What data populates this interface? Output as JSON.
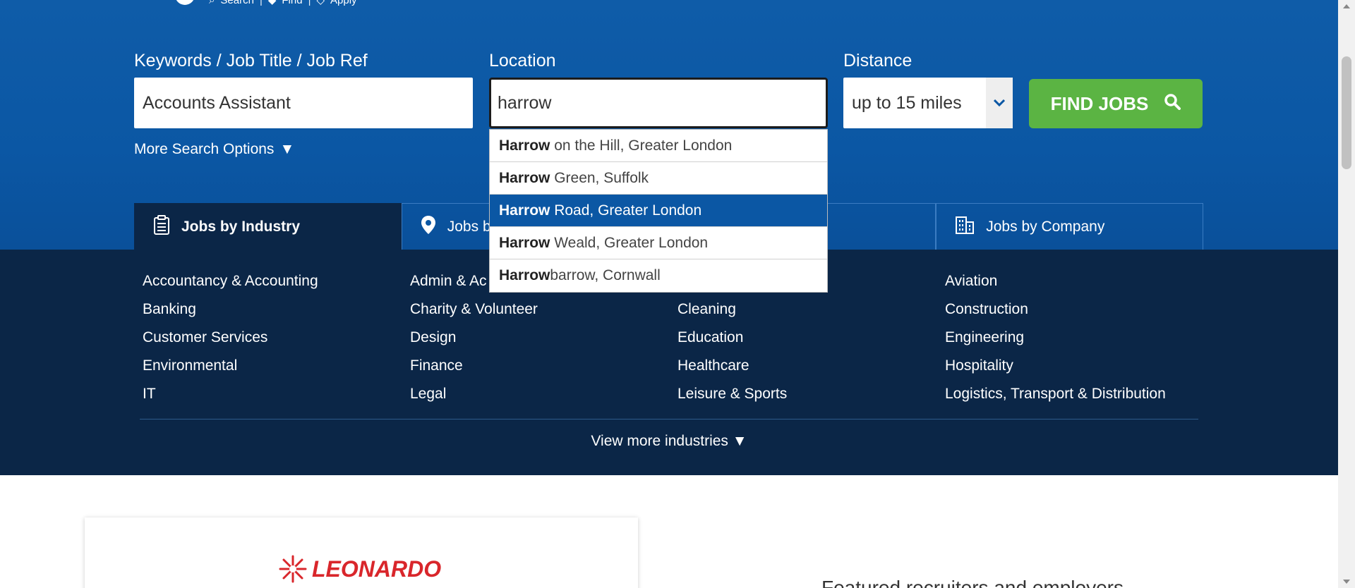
{
  "topnav": {
    "items": [
      "Search",
      "Find",
      "Apply"
    ],
    "separator": "|"
  },
  "search": {
    "keywords_label": "Keywords / Job Title / Job Ref",
    "keywords_value": "Accounts Assistant",
    "location_label": "Location",
    "location_value": "harrow",
    "distance_label": "Distance",
    "distance_value": "up to 15 miles",
    "find_button": "FIND JOBS",
    "more_options": "More Search Options"
  },
  "suggestions": [
    {
      "bold": "Harrow",
      "rest": " on the Hill, Greater London"
    },
    {
      "bold": "Harrow",
      "rest": " Green, Suffolk"
    },
    {
      "bold": "Harrow",
      "rest": " Road, Greater London"
    },
    {
      "bold": "Harrow",
      "rest": " Weald, Greater London"
    },
    {
      "bold": "Harrow",
      "rest": "barrow, Cornwall"
    }
  ],
  "tabs": [
    "Jobs by Industry",
    "Jobs b",
    "",
    "Jobs by Company"
  ],
  "industries": [
    "Accountancy & Accounting",
    "Admin & Ac",
    "",
    "Aviation",
    "Banking",
    "Charity & Volunteer",
    "Cleaning",
    "Construction",
    "Customer Services",
    "Design",
    "Education",
    "Engineering",
    "Environmental",
    "Finance",
    "Healthcare",
    "Hospitality",
    "IT",
    "Legal",
    "Leisure & Sports",
    "Logistics, Transport & Distribution"
  ],
  "view_more": "View more industries",
  "featured": {
    "logo_text": "LEONARDO",
    "heading": "Featured recruiters and employers"
  },
  "colors": {
    "brand_blue": "#0b57a4",
    "dark_navy": "#0b2647",
    "find_green": "#5bb443",
    "leonardo_red": "#d9262b"
  }
}
